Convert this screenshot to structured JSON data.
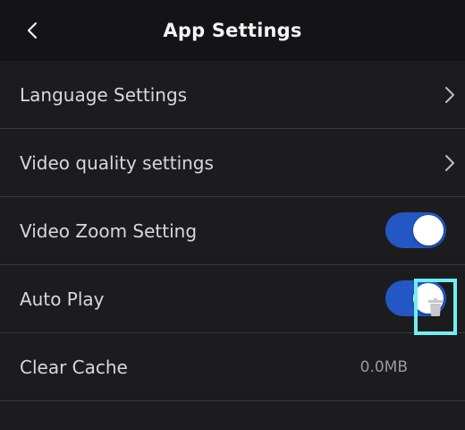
{
  "header": {
    "title": "App Settings",
    "back_icon": "chevron-left-icon"
  },
  "settings": {
    "language": {
      "label": "Language Settings",
      "icon": "chevron-right-icon"
    },
    "video_quality": {
      "label": "Video quality settings",
      "icon": "chevron-right-icon"
    },
    "video_zoom": {
      "label": "Video Zoom Setting",
      "enabled": true
    },
    "auto_play": {
      "label": "Auto Play",
      "enabled": true
    },
    "clear_cache": {
      "label": "Clear Cache",
      "size": "0.0MB",
      "icon": "trash-icon"
    }
  },
  "colors": {
    "background": "#1c1c1f",
    "header_background": "#141417",
    "toggle_on": "#2357c4",
    "highlight": "#6ff0f2"
  }
}
